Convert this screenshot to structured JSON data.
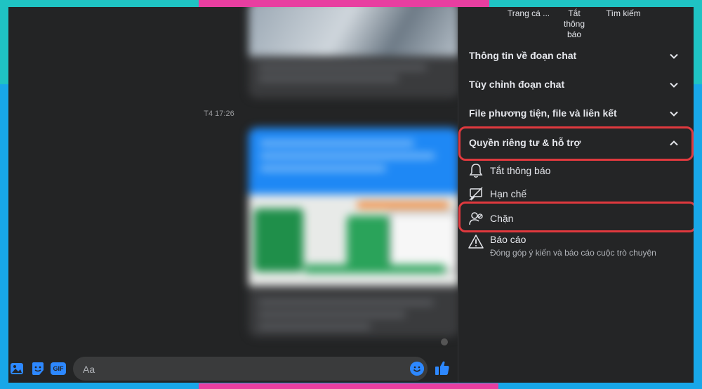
{
  "composer": {
    "placeholder": "Aa",
    "icons": [
      "photo-icon",
      "sticker-icon",
      "gif-icon",
      "emoji-icon",
      "like-icon"
    ],
    "gif_label": "GIF"
  },
  "chat": {
    "timestamp": "T4 17:26"
  },
  "panel": {
    "actions": [
      {
        "label": "Trang cá ..."
      },
      {
        "label": "Tắt thông báo"
      },
      {
        "label": "Tìm kiếm"
      }
    ],
    "sections": [
      {
        "label": "Thông tin về đoạn chat",
        "expanded": false
      },
      {
        "label": "Tùy chỉnh đoạn chat",
        "expanded": false
      },
      {
        "label": "File phương tiện, file và liên kết",
        "expanded": false
      },
      {
        "label": "Quyền riêng tư & hỗ trợ",
        "expanded": true
      }
    ],
    "privacy_items": [
      {
        "label": "Tắt thông báo",
        "icon": "bell-icon"
      },
      {
        "label": "Hạn chế",
        "icon": "restrict-icon"
      },
      {
        "label": "Chặn",
        "icon": "block-user-icon"
      },
      {
        "label": "Báo cáo",
        "icon": "warning-icon",
        "description": "Đóng góp ý kiến và báo cáo cuộc trò chuyện"
      }
    ]
  },
  "colors": {
    "highlight": "#e0393e",
    "accent": "#2d88ff",
    "panel_bg": "#242526"
  }
}
